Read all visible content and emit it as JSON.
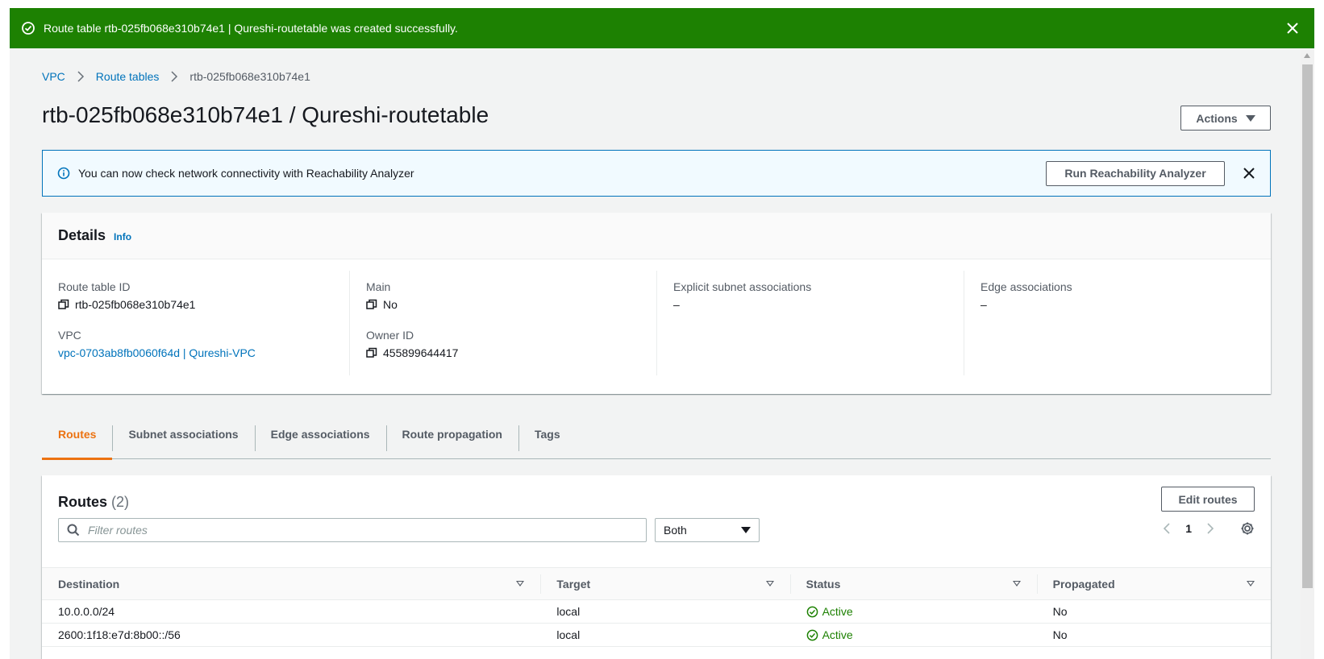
{
  "flash": {
    "message": "Route table rtb-025fb068e310b74e1 | Qureshi-routetable was created successfully."
  },
  "breadcrumb": {
    "items": [
      "VPC",
      "Route tables"
    ],
    "current": "rtb-025fb068e310b74e1"
  },
  "page": {
    "title": "rtb-025fb068e310b74e1 / Qureshi-routetable",
    "actions_label": "Actions"
  },
  "info_banner": {
    "text": "You can now check network connectivity with Reachability Analyzer",
    "button_label": "Run Reachability Analyzer"
  },
  "details": {
    "title": "Details",
    "info_link": "Info",
    "route_table_id": {
      "label": "Route table ID",
      "value": "rtb-025fb068e310b74e1"
    },
    "vpc": {
      "label": "VPC",
      "value": "vpc-0703ab8fb0060f64d | Qureshi-VPC"
    },
    "main": {
      "label": "Main",
      "value": "No"
    },
    "owner_id": {
      "label": "Owner ID",
      "value": "455899644417"
    },
    "explicit_subnet": {
      "label": "Explicit subnet associations",
      "value": "–"
    },
    "edge_associations": {
      "label": "Edge associations",
      "value": "–"
    }
  },
  "tabs": [
    "Routes",
    "Subnet associations",
    "Edge associations",
    "Route propagation",
    "Tags"
  ],
  "routes": {
    "title": "Routes",
    "count": "(2)",
    "edit_label": "Edit routes",
    "filter_placeholder": "Filter routes",
    "select_value": "Both",
    "page": "1",
    "columns": [
      "Destination",
      "Target",
      "Status",
      "Propagated"
    ],
    "rows": [
      {
        "destination": "10.0.0.0/24",
        "target": "local",
        "status": "Active",
        "propagated": "No"
      },
      {
        "destination": "2600:1f18:e7d:8b00::/56",
        "target": "local",
        "status": "Active",
        "propagated": "No"
      }
    ]
  },
  "colors": {
    "success": "#1d8102",
    "link": "#0073bb",
    "active_tab": "#ec7211"
  }
}
